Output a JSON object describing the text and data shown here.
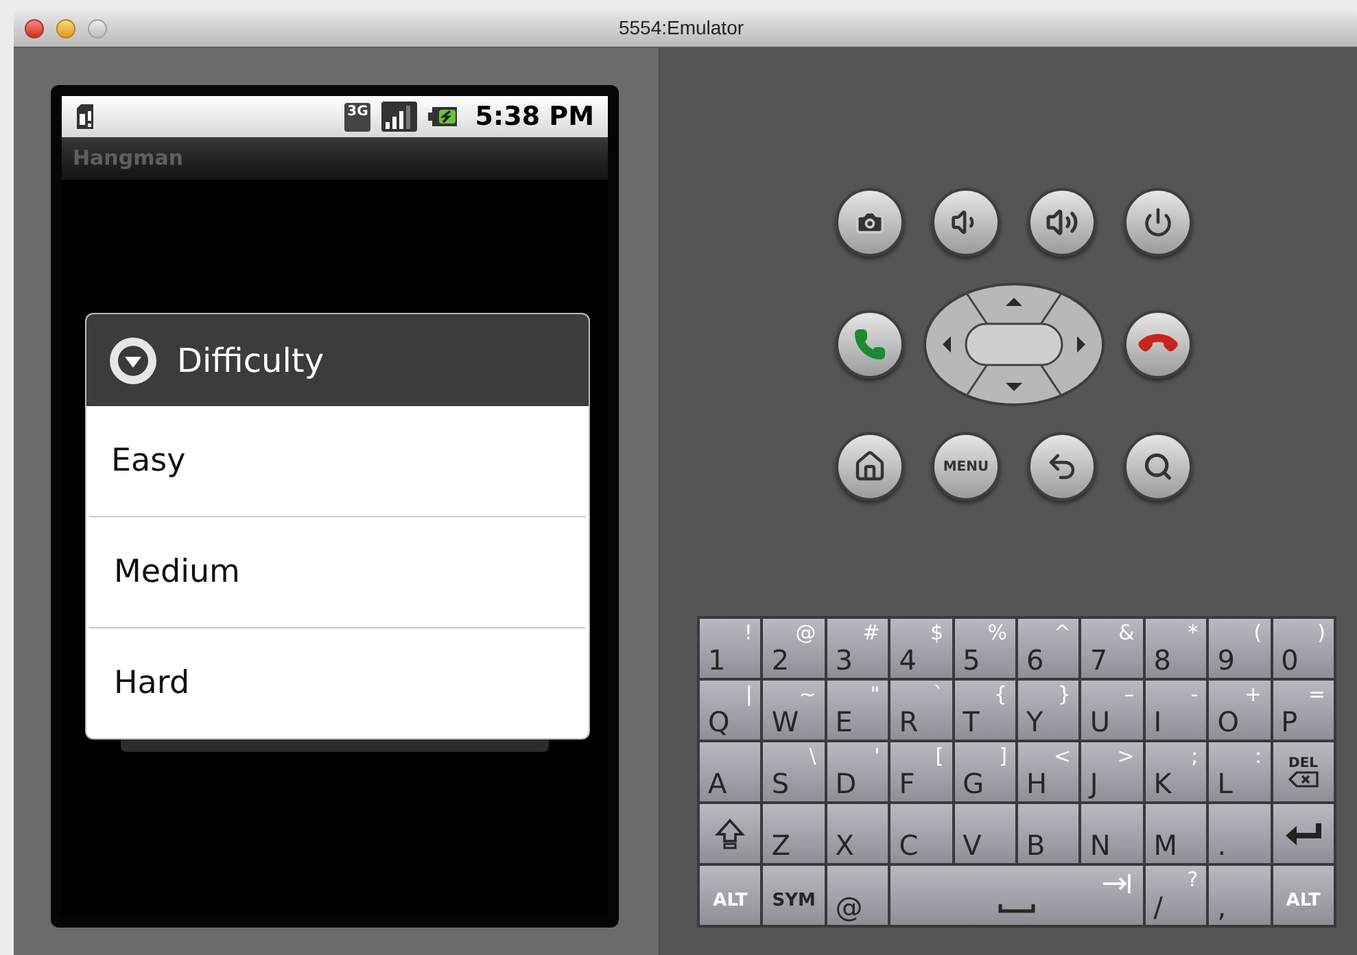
{
  "window": {
    "title": "5554:Emulator"
  },
  "phone": {
    "status_bar": {
      "network": "3G",
      "time": "5:38 PM"
    },
    "app_title": "Hangman",
    "dialog": {
      "title": "Difficulty",
      "items": [
        {
          "label": "Easy"
        },
        {
          "label": "Medium"
        },
        {
          "label": "Hard"
        }
      ]
    }
  },
  "controls": {
    "menu_label": "MENU"
  },
  "keyboard": {
    "rows": [
      [
        {
          "kind": "char",
          "main": "1",
          "alt": "!"
        },
        {
          "kind": "char",
          "main": "2",
          "alt": "@"
        },
        {
          "kind": "char",
          "main": "3",
          "alt": "#"
        },
        {
          "kind": "char",
          "main": "4",
          "alt": "$"
        },
        {
          "kind": "char",
          "main": "5",
          "alt": "%"
        },
        {
          "kind": "char",
          "main": "6",
          "alt": "^"
        },
        {
          "kind": "char",
          "main": "7",
          "alt": "&"
        },
        {
          "kind": "char",
          "main": "8",
          "alt": "*"
        },
        {
          "kind": "char",
          "main": "9",
          "alt": "("
        },
        {
          "kind": "char",
          "main": "0",
          "alt": ")"
        }
      ],
      [
        {
          "kind": "char",
          "main": "Q",
          "alt": "|"
        },
        {
          "kind": "char",
          "main": "W",
          "alt": "~"
        },
        {
          "kind": "char",
          "main": "E",
          "alt": "\""
        },
        {
          "kind": "char",
          "main": "R",
          "alt": "`"
        },
        {
          "kind": "char",
          "main": "T",
          "alt": "{"
        },
        {
          "kind": "char",
          "main": "Y",
          "alt": "}"
        },
        {
          "kind": "char",
          "main": "U",
          "alt": "–"
        },
        {
          "kind": "char",
          "main": "I",
          "alt": "-"
        },
        {
          "kind": "char",
          "main": "O",
          "alt": "+"
        },
        {
          "kind": "char",
          "main": "P",
          "alt": "="
        }
      ],
      [
        {
          "kind": "char",
          "main": "A"
        },
        {
          "kind": "char",
          "main": "S",
          "alt": "\\"
        },
        {
          "kind": "char",
          "main": "D",
          "alt": "'"
        },
        {
          "kind": "char",
          "main": "F",
          "alt": "["
        },
        {
          "kind": "char",
          "main": "G",
          "alt": "]"
        },
        {
          "kind": "char",
          "main": "H",
          "alt": "<"
        },
        {
          "kind": "char",
          "main": "J",
          "alt": ">"
        },
        {
          "kind": "char",
          "main": "K",
          "alt": ";"
        },
        {
          "kind": "char",
          "main": "L",
          "alt": ":"
        },
        {
          "kind": "del",
          "main": "DEL"
        }
      ],
      [
        {
          "kind": "shift"
        },
        {
          "kind": "char",
          "main": "Z"
        },
        {
          "kind": "char",
          "main": "X"
        },
        {
          "kind": "char",
          "main": "C"
        },
        {
          "kind": "char",
          "main": "V"
        },
        {
          "kind": "char",
          "main": "B"
        },
        {
          "kind": "char",
          "main": "N"
        },
        {
          "kind": "char",
          "main": "M"
        },
        {
          "kind": "char",
          "main": "."
        },
        {
          "kind": "enter"
        }
      ],
      [
        {
          "kind": "alt",
          "main": "ALT"
        },
        {
          "kind": "sym",
          "main": "SYM"
        },
        {
          "kind": "char",
          "main": "@"
        },
        {
          "kind": "space"
        },
        "",
        "",
        "",
        {
          "kind": "char",
          "main": "/",
          "alt": "?"
        },
        {
          "kind": "char",
          "main": ","
        },
        {
          "kind": "alt",
          "main": "ALT"
        }
      ]
    ]
  }
}
